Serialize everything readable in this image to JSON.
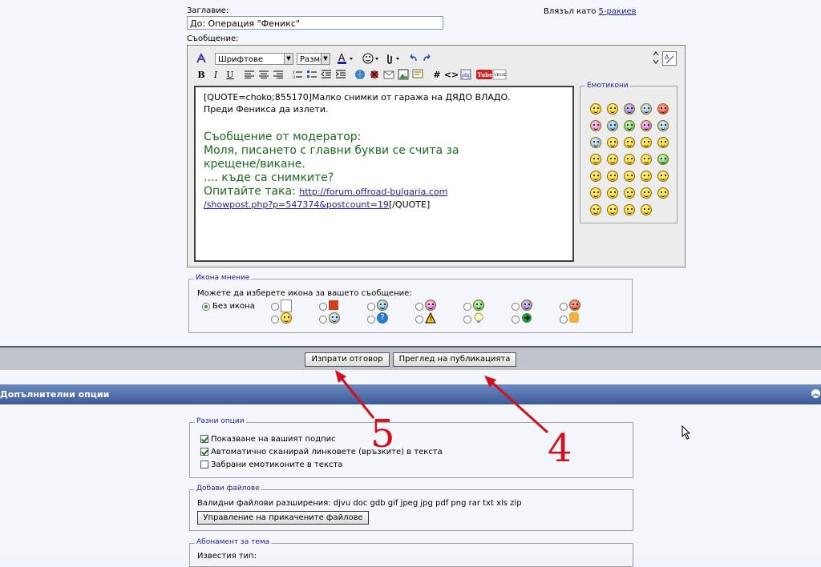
{
  "form": {
    "title_label": "Заглавие:",
    "title_value": "До: Операция \"Феникс\"",
    "message_label": "Съобщение:",
    "logged_prefix": "Влязъл като",
    "logged_user": "5-ракиев"
  },
  "toolbar": {
    "font_select": "Шрифтове",
    "size_select": "Разме",
    "smilies_title": "Емотикони"
  },
  "message": {
    "line1": "[QUOTE=choko;855170]Малко снимки от гаража на ДЯДО ВЛАДО.",
    "line2": "Преди Феникса да излети.",
    "mod1": "Съобщение от модератор:",
    "mod2": "Моля, писането с главни букви се счита за",
    "mod3": "крещене/викане.",
    "mod4": ".... къде са снимките?",
    "mod5_prefix": "Опитайте така:",
    "link_part1": "http://forum.offroad-bulgaria.com",
    "link_part2": "/showpost.php?p=547374&postcount=19",
    "tail": "[/QUOTE]"
  },
  "post_icons": {
    "legend": "Икона мнение",
    "prompt": "Можете да изберете икона за вашето съобщение:",
    "no_icon": "Без икона"
  },
  "buttons": {
    "submit": "Изпрати отговор",
    "preview": "Преглед на публикацията"
  },
  "annotations": {
    "five": "5",
    "four": "4",
    "color": "#d0101a"
  },
  "additional": {
    "header": "Допълнителни опции",
    "misc_legend": "Разни опции",
    "opt_signature": "Показване на вашият подпис",
    "opt_links": "Автоматично сканирай линковете (връзките) в текста",
    "opt_smilies": "Забрани емотиконите в текста",
    "files_legend": "Добави файлове",
    "files_ext": "Валидни файлови разширения: djvu doc gdb gif jpeg jpg pdf png rar txt xls zip",
    "files_button": "Управление на прикачените файлове",
    "sub_legend": "Абонамент за тема",
    "sub_known": "Известия тип:"
  }
}
